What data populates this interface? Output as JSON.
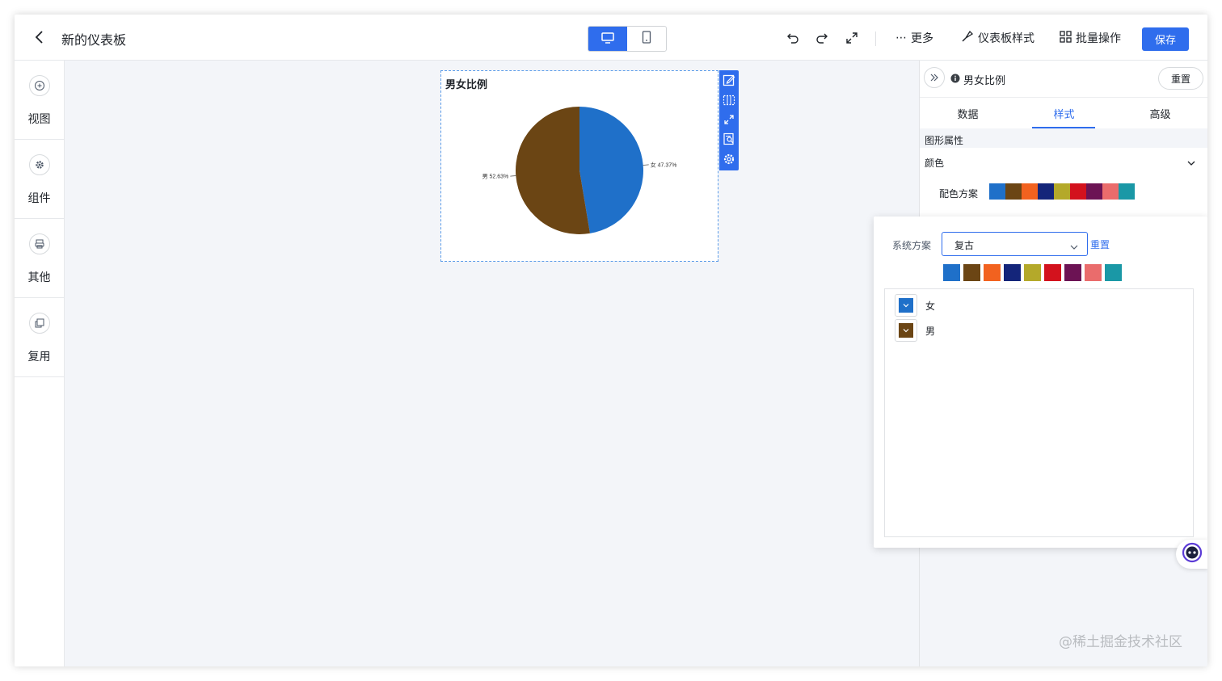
{
  "header": {
    "title": "新的仪表板",
    "more_label": "更多",
    "style_label": "仪表板样式",
    "batch_label": "批量操作",
    "save_label": "保存"
  },
  "sidebar": {
    "items": [
      {
        "label": "视图",
        "icon": "plus-circle-icon"
      },
      {
        "label": "组件",
        "icon": "gear-icon"
      },
      {
        "label": "其他",
        "icon": "printer-icon"
      },
      {
        "label": "复用",
        "icon": "copy-icon"
      }
    ]
  },
  "card": {
    "title": "男女比例"
  },
  "chart_data": {
    "type": "pie",
    "title": "男女比例",
    "slices": [
      {
        "name": "女",
        "value": 47.37,
        "label": "女 47.37%",
        "color": "#1f70c9"
      },
      {
        "name": "男",
        "value": 52.63,
        "label": "男 52.63%",
        "color": "#6b4514"
      }
    ]
  },
  "panel": {
    "title": "男女比例",
    "reset_label": "重置",
    "tabs": [
      "数据",
      "样式",
      "高级"
    ],
    "active_tab": "样式",
    "section_title": "图形属性",
    "color_label": "颜色",
    "scheme_label": "配色方案"
  },
  "palette": [
    "#1f70c9",
    "#6b4514",
    "#f2621f",
    "#14257a",
    "#b4a92a",
    "#d3121d",
    "#6c1354",
    "#ea6c6c",
    "#1a98a6"
  ],
  "popover": {
    "system_label": "系统方案",
    "system_value": "复古",
    "reset_label": "重置",
    "series": [
      {
        "name": "女",
        "color": "#1f70c9"
      },
      {
        "name": "男",
        "color": "#6b4514"
      }
    ]
  },
  "watermark": "@稀土掘金技术社区"
}
